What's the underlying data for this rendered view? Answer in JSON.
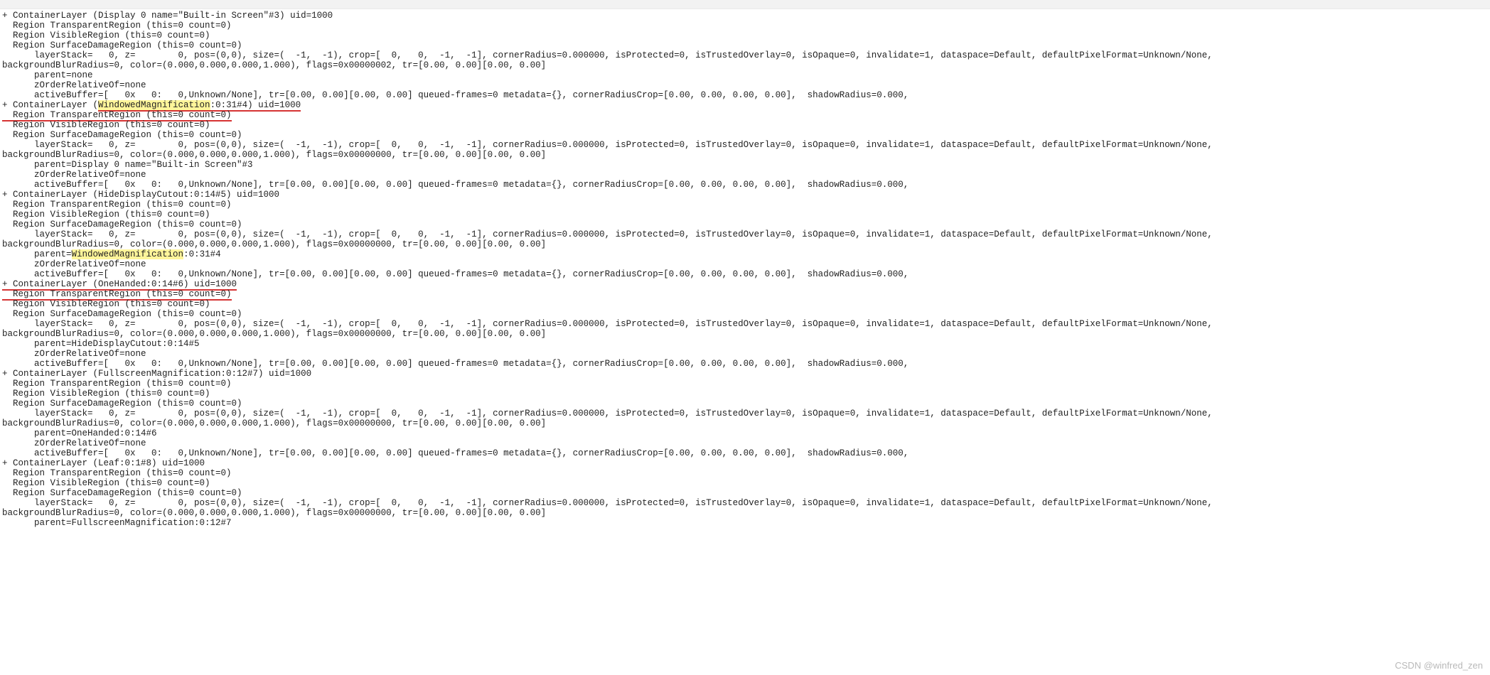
{
  "watermark": "CSDN @winfred_zen",
  "layers": [
    {
      "header_pre": "+ ContainerLayer (Display 0 name=\"Built-in Screen\"#3) uid=1000",
      "region_transparent": "  Region TransparentRegion (this=0 count=0)",
      "region_visible": "  Region VisibleRegion (this=0 count=0)",
      "region_damage": "  Region SurfaceDamageRegion (this=0 count=0)",
      "l1": "      layerStack=   0, z=        0, pos=(0,0), size=(  -1,  -1), crop=[  0,   0,  -1,  -1], cornerRadius=0.000000, isProtected=0, isTrustedOverlay=0, isOpaque=0, invalidate=1, dataspace=Default, defaultPixelFormat=Unknown/None,",
      "l2": "backgroundBlurRadius=0, color=(0.000,0.000,0.000,1.000), flags=0x00000002, tr=[0.00, 0.00][0.00, 0.00]",
      "parent": "      parent=none",
      "zorder": "      zOrderRelativeOf=none",
      "buf": "      activeBuffer=[   0x   0:   0,Unknown/None], tr=[0.00, 0.00][0.00, 0.00] queued-frames=0 metadata={}, cornerRadiusCrop=[0.00, 0.00, 0.00, 0.00],  shadowRadius=0.000,"
    },
    {
      "header_pre": "+ ContainerLayer (",
      "header_hl1": "WindowedMagnification",
      "header_mid": ":0:31#4) uid=1000",
      "region_transparent": "  Region TransparentRegion (this=0 count=0)",
      "region_visible": "  Region VisibleRegion (this=0 count=0)",
      "region_damage": "  Region SurfaceDamageRegion (this=0 count=0)",
      "l1": "      layerStack=   0, z=        0, pos=(0,0), size=(  -1,  -1), crop=[  0,   0,  -1,  -1], cornerRadius=0.000000, isProtected=0, isTrustedOverlay=0, isOpaque=0, invalidate=1, dataspace=Default, defaultPixelFormat=Unknown/None,",
      "l2": "backgroundBlurRadius=0, color=(0.000,0.000,0.000,1.000), flags=0x00000000, tr=[0.00, 0.00][0.00, 0.00]",
      "parent": "      parent=Display 0 name=\"Built-in Screen\"#3",
      "zorder": "      zOrderRelativeOf=none",
      "buf": "      activeBuffer=[   0x   0:   0,Unknown/None], tr=[0.00, 0.00][0.00, 0.00] queued-frames=0 metadata={}, cornerRadiusCrop=[0.00, 0.00, 0.00, 0.00],  shadowRadius=0.000,"
    },
    {
      "header_pre": "+ ContainerLayer (HideDisplayCutout:0:14#5) uid=1000",
      "region_transparent": "  Region TransparentRegion (this=0 count=0)",
      "region_visible": "  Region VisibleRegion (this=0 count=0)",
      "region_damage": "  Region SurfaceDamageRegion (this=0 count=0)",
      "l1": "      layerStack=   0, z=        0, pos=(0,0), size=(  -1,  -1), crop=[  0,   0,  -1,  -1], cornerRadius=0.000000, isProtected=0, isTrustedOverlay=0, isOpaque=0, invalidate=1, dataspace=Default, defaultPixelFormat=Unknown/None,",
      "l2": "backgroundBlurRadius=0, color=(0.000,0.000,0.000,1.000), flags=0x00000000, tr=[0.00, 0.00][0.00, 0.00]",
      "parent_pre": "      parent=",
      "parent_hl": "WindowedMagnification",
      "parent_post": ":0:31#4",
      "zorder": "      zOrderRelativeOf=none",
      "buf": "      activeBuffer=[   0x   0:   0,Unknown/None], tr=[0.00, 0.00][0.00, 0.00] queued-frames=0 metadata={}, cornerRadiusCrop=[0.00, 0.00, 0.00, 0.00],  shadowRadius=0.000,"
    },
    {
      "header_pre": "+ ContainerLayer (OneHanded:0:14#6) uid=1000",
      "region_transparent": "  Region TransparentRegion (this=0 count=0)",
      "region_visible": "  Region VisibleRegion (this=0 count=0)",
      "region_damage": "  Region SurfaceDamageRegion (this=0 count=0)",
      "l1": "      layerStack=   0, z=        0, pos=(0,0), size=(  -1,  -1), crop=[  0,   0,  -1,  -1], cornerRadius=0.000000, isProtected=0, isTrustedOverlay=0, isOpaque=0, invalidate=1, dataspace=Default, defaultPixelFormat=Unknown/None,",
      "l2": "backgroundBlurRadius=0, color=(0.000,0.000,0.000,1.000), flags=0x00000000, tr=[0.00, 0.00][0.00, 0.00]",
      "parent": "      parent=HideDisplayCutout:0:14#5",
      "zorder": "      zOrderRelativeOf=none",
      "buf": "      activeBuffer=[   0x   0:   0,Unknown/None], tr=[0.00, 0.00][0.00, 0.00] queued-frames=0 metadata={}, cornerRadiusCrop=[0.00, 0.00, 0.00, 0.00],  shadowRadius=0.000,"
    },
    {
      "header_pre": "+ ContainerLayer (FullscreenMagnification:0:12#7) uid=1000",
      "region_transparent": "  Region TransparentRegion (this=0 count=0)",
      "region_visible": "  Region VisibleRegion (this=0 count=0)",
      "region_damage": "  Region SurfaceDamageRegion (this=0 count=0)",
      "l1": "      layerStack=   0, z=        0, pos=(0,0), size=(  -1,  -1), crop=[  0,   0,  -1,  -1], cornerRadius=0.000000, isProtected=0, isTrustedOverlay=0, isOpaque=0, invalidate=1, dataspace=Default, defaultPixelFormat=Unknown/None,",
      "l2": "backgroundBlurRadius=0, color=(0.000,0.000,0.000,1.000), flags=0x00000000, tr=[0.00, 0.00][0.00, 0.00]",
      "parent": "      parent=OneHanded:0:14#6",
      "zorder": "      zOrderRelativeOf=none",
      "buf": "      activeBuffer=[   0x   0:   0,Unknown/None], tr=[0.00, 0.00][0.00, 0.00] queued-frames=0 metadata={}, cornerRadiusCrop=[0.00, 0.00, 0.00, 0.00],  shadowRadius=0.000,"
    },
    {
      "header_pre": "+ ContainerLayer (Leaf:0:1#8) uid=1000",
      "region_transparent": "  Region TransparentRegion (this=0 count=0)",
      "region_visible": "  Region VisibleRegion (this=0 count=0)",
      "region_damage": "  Region SurfaceDamageRegion (this=0 count=0)",
      "l1": "      layerStack=   0, z=        0, pos=(0,0), size=(  -1,  -1), crop=[  0,   0,  -1,  -1], cornerRadius=0.000000, isProtected=0, isTrustedOverlay=0, isOpaque=0, invalidate=1, dataspace=Default, defaultPixelFormat=Unknown/None,",
      "l2": "backgroundBlurRadius=0, color=(0.000,0.000,0.000,1.000), flags=0x00000000, tr=[0.00, 0.00][0.00, 0.00]",
      "parent": "      parent=FullscreenMagnification:0:12#7"
    }
  ]
}
